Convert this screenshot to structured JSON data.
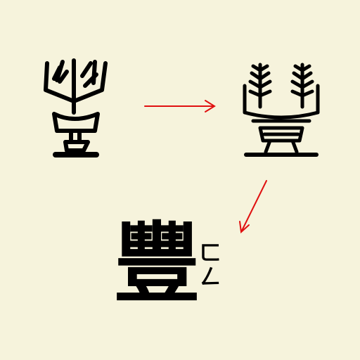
{
  "modern_character": "豐",
  "bopomofo": [
    "ㄈ",
    "ㄥ"
  ],
  "arrow_color": "#e01010",
  "background_color": "#f6f3dc"
}
